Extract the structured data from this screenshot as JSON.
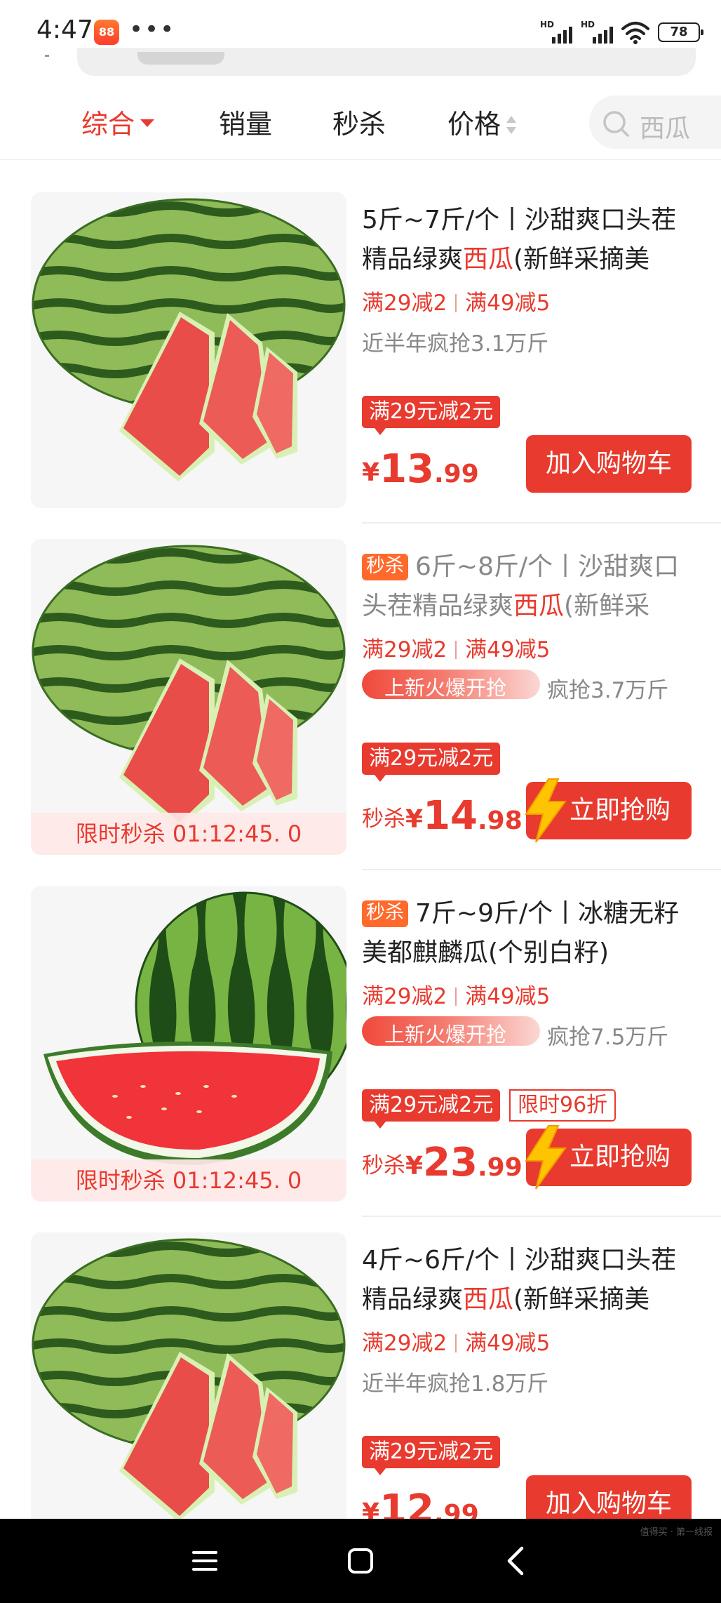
{
  "status_bar": {
    "time": "4:47",
    "app_badge": "88",
    "more": "•••",
    "signal_1": "HD",
    "signal_2": "HD",
    "battery": "78"
  },
  "filter": {
    "tabs": [
      {
        "label": "综合",
        "active": true
      },
      {
        "label": "销量",
        "active": false
      },
      {
        "label": "秒杀",
        "active": false
      },
      {
        "label": "价格",
        "active": false
      }
    ],
    "search_placeholder": "西瓜"
  },
  "products": [
    {
      "title_a": "5斤~7斤/个丨沙甜爽口头茬精品绿爽",
      "title_hl": "西瓜",
      "title_b": "(新鲜采摘美",
      "promo_1": "满29减2",
      "promo_2": "满49减5",
      "sales": "近半年疯抢3.1万斤",
      "coupon": "满29元减2元",
      "currency": "¥",
      "price_int": "13",
      "price_dec": ".99",
      "button": "加入购物车"
    },
    {
      "badge": "秒杀",
      "title_a": "6斤~8斤/个丨沙甜爽口头茬精品绿爽",
      "title_hl": "西瓜",
      "title_b": "(新鲜采",
      "promo_1": "满29减2",
      "promo_2": "满49减5",
      "hot": "上新火爆开抢",
      "sales": "疯抢3.7万斤",
      "coupon": "满29元减2元",
      "price_label": "秒杀",
      "currency": "¥",
      "price_int": "14",
      "price_dec": ".98",
      "button": "立即抢购",
      "flash": "限时秒杀 01:12:45. 0"
    },
    {
      "badge": "秒杀",
      "title_a": "7斤~9斤/个丨冰糖无籽美都麒麟瓜(个别白籽)",
      "promo_1": "满29减2",
      "promo_2": "满49减5",
      "hot": "上新火爆开抢",
      "sales": "疯抢7.5万斤",
      "coupon": "满29元减2元",
      "discount": "限时96折",
      "price_label": "秒杀",
      "currency": "¥",
      "price_int": "23",
      "price_dec": ".99",
      "button": "立即抢购",
      "flash": "限时秒杀 01:12:45. 0"
    },
    {
      "title_a": "4斤~6斤/个丨沙甜爽口头茬精品绿爽",
      "title_hl": "西瓜",
      "title_b": "(新鲜采摘美",
      "promo_1": "满29减2",
      "promo_2": "满49减5",
      "sales": "近半年疯抢1.8万斤",
      "coupon": "满29元减2元",
      "currency": "¥",
      "price_int": "12",
      "price_dec": ".99",
      "button": "加入购物车"
    }
  ],
  "watermark": "值得买 · 第一线报",
  "colors": {
    "accent": "#e83a2e",
    "badge": "#ff6a2c",
    "bolt": "#ffc400"
  }
}
